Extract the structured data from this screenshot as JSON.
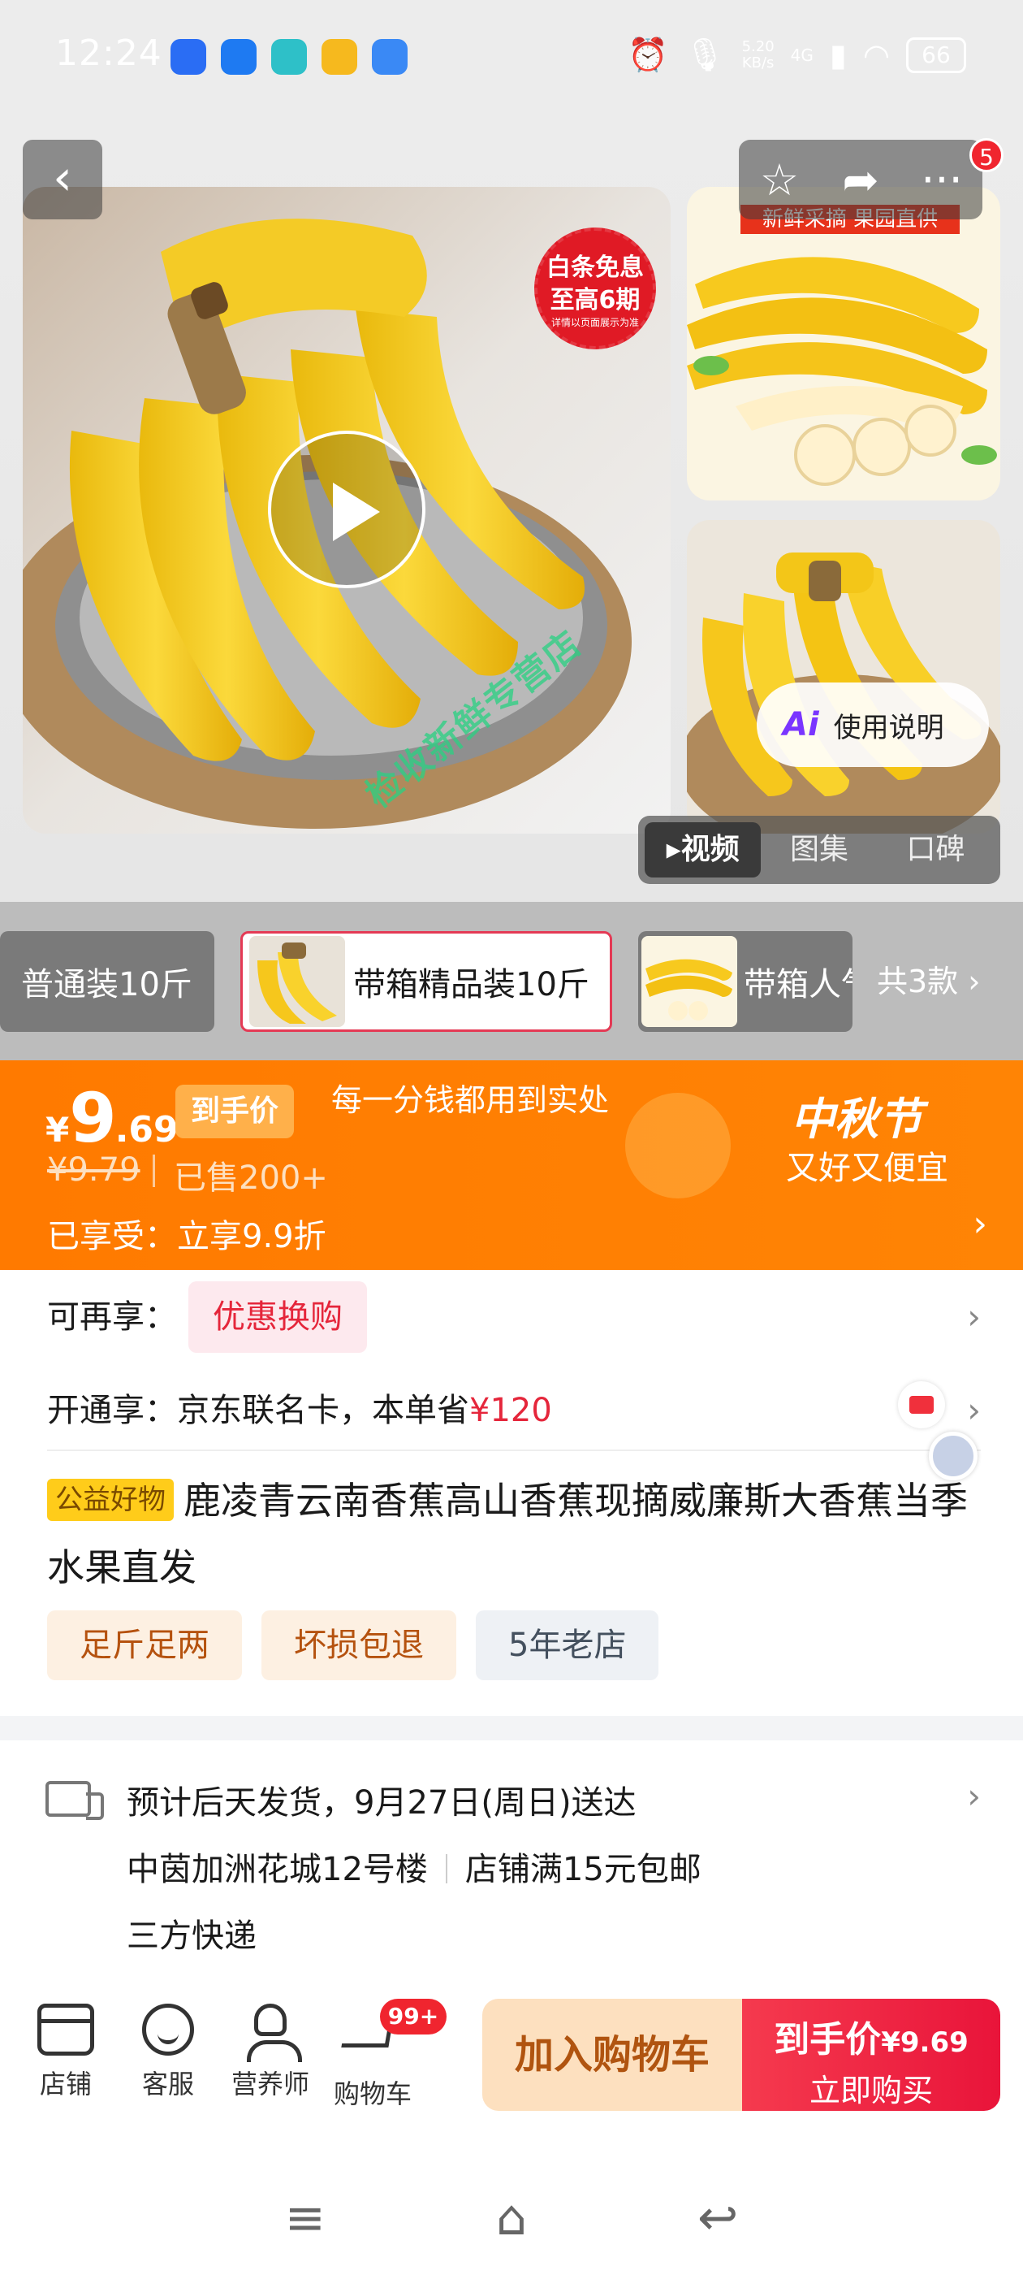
{
  "status_bar": {
    "time": "12:24",
    "network_speed_value": "5.20",
    "network_speed_unit": "KB/s",
    "signal_type": "4G",
    "battery": "66",
    "app_icon_colors": [
      "#2a6df4",
      "#1e7af2",
      "#2ec0c8",
      "#f6b91e",
      "#3a89f5"
    ]
  },
  "gallery": {
    "main_badge_line1": "白条免息",
    "main_badge_line2": "至高6期",
    "main_badge_note": "详情以页面展示为准",
    "thumb1_label": "新鲜采摘 果园直供",
    "watermark": "检收新鲜专营店",
    "notification_count": "5",
    "ai_button": "使用说明",
    "ai_icon_text": "Ai",
    "media_tabs": [
      "视频",
      "图集",
      "口碑"
    ],
    "icons": {
      "back": "chevron-left-icon",
      "favorite": "star-icon",
      "share": "share-icon",
      "more": "more-icon",
      "play": "play-icon"
    }
  },
  "sku": {
    "options": [
      "普通装10斤",
      "带箱精品装10斤",
      "带箱人气"
    ],
    "selected_index": 1,
    "total": "共3款 ›"
  },
  "price_banner": {
    "currency": "¥",
    "price_int": "9",
    "price_dec": ".69",
    "tag": "到手价",
    "slogan": "每一分钱都用到实处",
    "original_price": "¥9.79",
    "sold": "已售200+",
    "enjoyed": "已享受：立享9.9折",
    "festival_title": "中秋节",
    "festival_subtitle": "又好又便宜"
  },
  "rows": {
    "more_label": "可再享：",
    "more_chip": "优惠换购",
    "open_label": "开通享：京东联名卡，本单省",
    "open_amount": "¥120"
  },
  "product": {
    "badge": "公益好物",
    "title": "鹿凌青云南香蕉高山香蕉现摘威廉斯大香蕉当季水果直发",
    "tags": [
      "足斤足两",
      "坏损包退",
      "5年老店"
    ]
  },
  "delivery": {
    "line1": "预计后天发货，9月27日(周日)送达",
    "address": "中茵加洲花城12号楼",
    "shipping_rule": "店铺满15元包邮",
    "courier": "三方快递"
  },
  "bottom_bar": {
    "nav": [
      "店铺",
      "客服",
      "营养师",
      "购物车"
    ],
    "cart_badge": "99+",
    "add_to_cart": "加入购物车",
    "buy_price_label": "到手价",
    "buy_price": "¥9.69",
    "buy_now": "立即购买"
  },
  "colors": {
    "accent_orange": "#ff7a00",
    "accent_red": "#e9143a",
    "sku_selected_border": "#e43a55"
  }
}
